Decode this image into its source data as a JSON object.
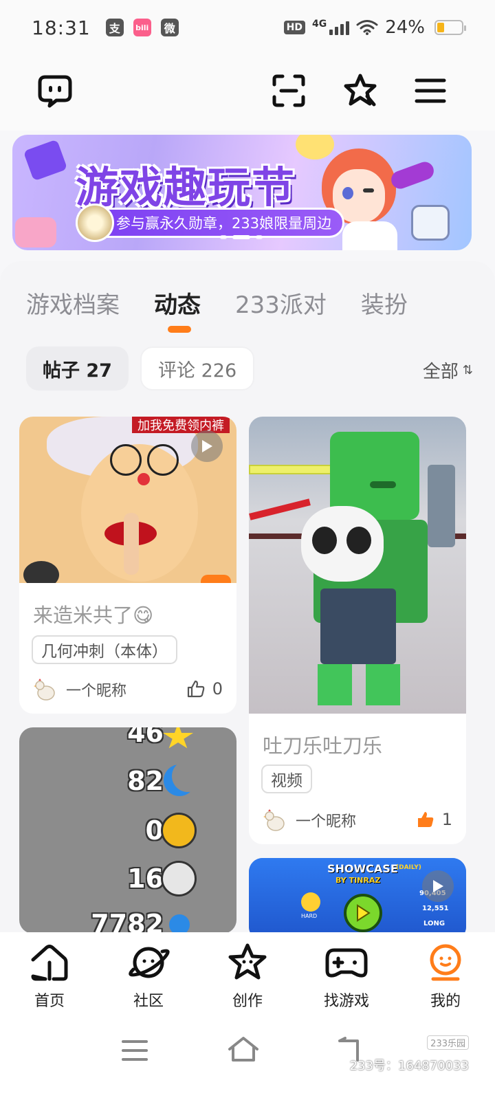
{
  "status_bar": {
    "time": "18:31",
    "apps": [
      "支",
      "bili",
      "微"
    ],
    "network": "4G",
    "hd": "HD",
    "battery": "24%",
    "battery_level": 0.24
  },
  "top_nav": {
    "icons": [
      "message-bubble-icon",
      "scan-icon",
      "star-badge-icon",
      "menu-icon"
    ]
  },
  "banner": {
    "title": "游戏趣玩节",
    "subtitle": "参与赢永久勋章，233娘限量周边",
    "page_count": 3,
    "active_page": 2
  },
  "tabs": [
    {
      "label": "游戏档案"
    },
    {
      "label": "动态",
      "active": true
    },
    {
      "label": "233派对"
    },
    {
      "label": "装扮"
    }
  ],
  "filters": {
    "posts": "帖子 27",
    "comments": "评论 226",
    "sort": "全部",
    "sort_icon": "⇅"
  },
  "posts": [
    {
      "overlay_text": "加我免费领内裤",
      "title": "来造米共了😋",
      "tag": "几何冲刺（本体）",
      "author": "一个昵称",
      "likes": "0",
      "liked": false
    },
    {
      "title": "吐刀乐吐刀乐",
      "tag": "视频",
      "author": "一个昵称",
      "likes": "1",
      "liked": true
    },
    {
      "stats": [
        "46",
        "82",
        "0",
        "16",
        "7782"
      ]
    },
    {
      "heading": "SHOWCASE",
      "heading_small": "(DAILY)",
      "by": "BY TINRAZ",
      "numbers": [
        "90,405",
        "12,551",
        "LONG"
      ],
      "difficulty": "HARD"
    }
  ],
  "bottom_nav": [
    {
      "label": "首页",
      "icon": "home-icon"
    },
    {
      "label": "社区",
      "icon": "planet-icon"
    },
    {
      "label": "创作",
      "icon": "star-face-icon"
    },
    {
      "label": "找游戏",
      "icon": "gamepad-icon"
    },
    {
      "label": "我的",
      "icon": "profile-face-icon",
      "active": true
    }
  ],
  "watermark": {
    "badge": "233乐园",
    "text": "233号：164870033"
  },
  "colors": {
    "accent": "#ff7d1a",
    "like_active": "#ff7d1a"
  }
}
